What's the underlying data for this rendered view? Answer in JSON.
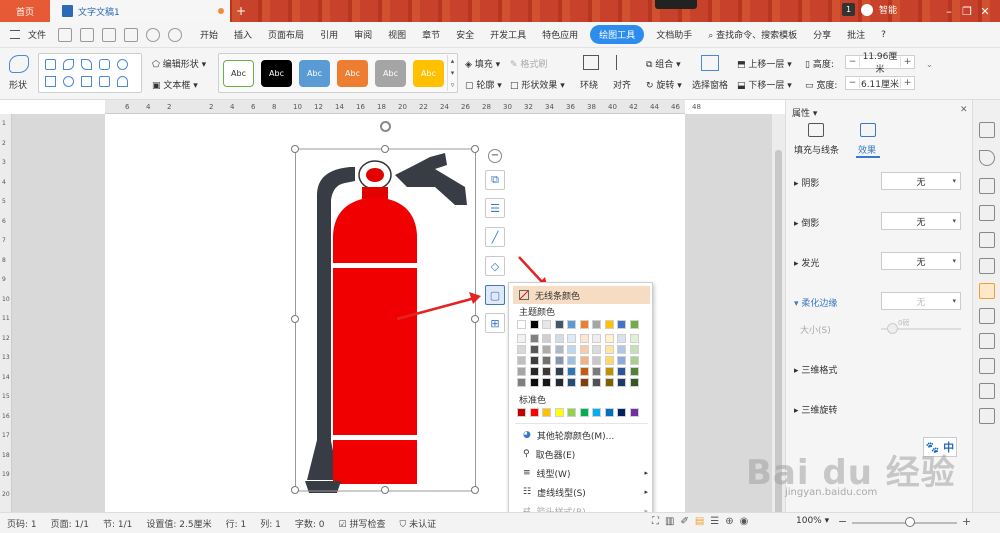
{
  "titlebar": {
    "home_tab": "首页",
    "doc_tab": "文字文稿1",
    "badge_num": "1",
    "user_label": "智能"
  },
  "menubar": {
    "file": "文件",
    "items": [
      "开始",
      "插入",
      "页面布局",
      "引用",
      "审阅",
      "视图",
      "章节",
      "安全",
      "开发工具",
      "特色应用"
    ],
    "active_tab": "绘图工具",
    "doc_helper": "文档助手",
    "search": "查找命令、搜索模板",
    "share": "分享",
    "comment": "批注",
    "help": "?"
  },
  "ribbon": {
    "shape": "形状",
    "edit_shape": "编辑形状",
    "textbox": "文本框",
    "style_buttons": [
      {
        "label": "Abc",
        "bg": "#ffffff",
        "fg": "#333333",
        "border": "#70ad47"
      },
      {
        "label": "Abc",
        "bg": "#000000",
        "fg": "#ffffff",
        "border": "#000000"
      },
      {
        "label": "Abc",
        "bg": "#5b9bd5",
        "fg": "#ffffff",
        "border": "#5b9bd5"
      },
      {
        "label": "Abc",
        "bg": "#ed7d31",
        "fg": "#ffffff",
        "border": "#ed7d31"
      },
      {
        "label": "Abc",
        "bg": "#a5a5a5",
        "fg": "#ffffff",
        "border": "#a5a5a5"
      },
      {
        "label": "Abc",
        "bg": "#ffc000",
        "fg": "#ffffff",
        "border": "#ffc000"
      }
    ],
    "fill": "填充",
    "format_brush": "格式刷",
    "outline": "轮廓",
    "shape_effect": "形状效果",
    "wrap": "环绕",
    "align": "对齐",
    "group": "组合",
    "rotate": "旋转",
    "selection_pane": "选择窗格",
    "bring_forward": "上移一层",
    "send_backward": "下移一层",
    "height_label": "高度:",
    "height_value": "11.96厘米",
    "width_label": "宽度:",
    "width_value": "6.11厘米"
  },
  "hruler_ticks": [
    "6",
    "4",
    "2",
    "",
    "2",
    "4",
    "6",
    "8",
    "10",
    "12",
    "14",
    "16",
    "18",
    "20",
    "22",
    "24",
    "26",
    "28",
    "30",
    "32",
    "34",
    "36",
    "38",
    "40",
    "42",
    "44",
    "46",
    "48"
  ],
  "vruler_ticks": [
    "1",
    "2",
    "3",
    "4",
    "5",
    "6",
    "7",
    "8",
    "9",
    "10",
    "11",
    "12",
    "13",
    "14",
    "15",
    "16",
    "17",
    "18",
    "19",
    "20"
  ],
  "popup": {
    "no_line": "无线条颜色",
    "theme_colors": "主题颜色",
    "theme_top": [
      "#ffffff",
      "#000000",
      "#e7e6e6",
      "#44546a",
      "#5b9bd5",
      "#ed7d31",
      "#a5a5a5",
      "#ffc000",
      "#4472c4",
      "#70ad47"
    ],
    "theme_shades": [
      [
        "#f2f2f2",
        "#808080",
        "#d0cece",
        "#d6dce4",
        "#deebf6",
        "#fbe5d5",
        "#ededed",
        "#fff2cc",
        "#d9e2f3",
        "#e2efd9"
      ],
      [
        "#d8d8d8",
        "#595959",
        "#aeabab",
        "#adb9ca",
        "#bdd7ee",
        "#f8cbad",
        "#dbdbdb",
        "#fee599",
        "#b4c6e7",
        "#c5e0b3"
      ],
      [
        "#bfbfbf",
        "#3f3f3f",
        "#757070",
        "#8496b0",
        "#9cc3e5",
        "#f4b183",
        "#c9c9c9",
        "#ffd966",
        "#8eaadb",
        "#a8d08d"
      ],
      [
        "#a5a5a5",
        "#262626",
        "#3a3838",
        "#323f4f",
        "#2e75b5",
        "#c55a11",
        "#7b7b7b",
        "#bf9000",
        "#2f5496",
        "#538135"
      ],
      [
        "#7f7f7f",
        "#0c0c0c",
        "#171616",
        "#222a35",
        "#1e4e79",
        "#833c0b",
        "#525252",
        "#7f6000",
        "#1f3864",
        "#375623"
      ]
    ],
    "standard_colors_label": "标准色",
    "standard_colors": [
      "#c00000",
      "#ff0000",
      "#ffc000",
      "#ffff00",
      "#92d050",
      "#00b050",
      "#00b0f0",
      "#0070c0",
      "#002060",
      "#7030a0"
    ],
    "more_colors": "其他轮廓颜色(M)...",
    "picker": "取色器(E)",
    "line_type": "线型(W)",
    "dash_type": "虚线线型(S)",
    "arrow_style": "箭头样式(R)"
  },
  "rpanel": {
    "title": "属性",
    "tab_fill": "填充与线条",
    "tab_effect": "效果",
    "shadow": "阴影",
    "reflection": "倒影",
    "glow": "发光",
    "soft_edge": "柔化边缘",
    "size": "大小(S)",
    "size_value": "0磅",
    "format_3d": "三维格式",
    "rotate_3d": "三维旋转",
    "none": "无"
  },
  "status": {
    "page_code": "页码: 1",
    "pages": "页面: 1/1",
    "section": "节: 1/1",
    "setting": "设置值: 2.5厘米",
    "row": "行: 1",
    "col": "列: 1",
    "words": "字数: 0",
    "spell": "拼写检查",
    "cert": "未认证",
    "zoom": "100%",
    "zoom_fraction": 0.55
  },
  "ime": {
    "paw": "🐾",
    "lang": "中"
  },
  "watermark": {
    "main": "Bai du 经验",
    "url": "jingyan.baidu.com"
  }
}
